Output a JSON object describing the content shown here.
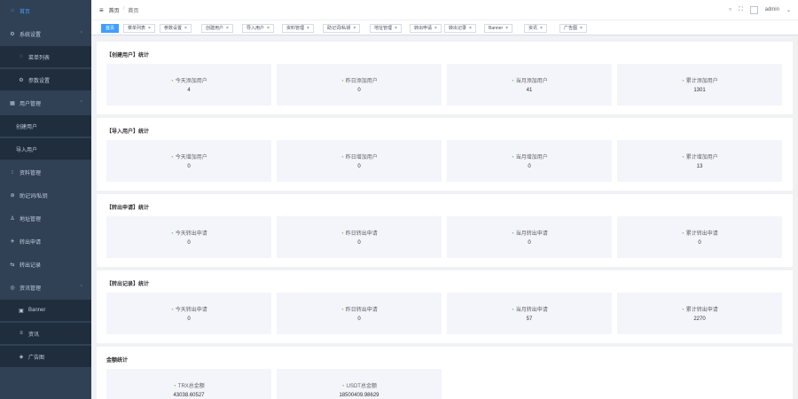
{
  "sidebar": {
    "items": [
      {
        "label": "首页",
        "icon": "home-icon",
        "glyph": "⌂"
      },
      {
        "label": "系统设置",
        "icon": "gear-icon",
        "glyph": "⚙",
        "arrow": "⌃"
      },
      {
        "label": "菜单列表",
        "icon": "menu-icon",
        "glyph": "◌"
      },
      {
        "label": "参数设置",
        "icon": "settings-icon",
        "glyph": "⚙"
      },
      {
        "label": "用户管理",
        "icon": "user-group-icon",
        "glyph": "▦",
        "arrow": "⌃"
      },
      {
        "label": "创建用户",
        "icon": "",
        "glyph": ""
      },
      {
        "label": "导入用户",
        "icon": "",
        "glyph": ""
      },
      {
        "label": "资料管理",
        "icon": "asset-icon",
        "glyph": "⁝"
      },
      {
        "label": "助记词/私钥",
        "icon": "key-icon",
        "glyph": "⊛"
      },
      {
        "label": "地址管理",
        "icon": "person-icon",
        "glyph": "♙"
      },
      {
        "label": "转出申请",
        "icon": "send-icon",
        "glyph": "✈"
      },
      {
        "label": "转出记录",
        "icon": "record-icon",
        "glyph": "⇆"
      },
      {
        "label": "资讯管理",
        "icon": "news-icon",
        "glyph": "◎",
        "arrow": "⌃"
      },
      {
        "label": "Banner",
        "icon": "image-icon",
        "glyph": "▣"
      },
      {
        "label": "资讯",
        "icon": "article-icon",
        "glyph": "≡"
      },
      {
        "label": "广告图",
        "icon": "ad-icon",
        "glyph": "◈"
      }
    ]
  },
  "header": {
    "crumb_home": "首页",
    "crumb_sep": "/",
    "crumb_current": "首页",
    "user": "admin",
    "hamburger_glyph": "≡",
    "search_glyph": "○",
    "fullscreen_glyph": "⛶",
    "dropdown_glyph": "⌄"
  },
  "tags": [
    {
      "label": "首页",
      "active": true
    },
    {
      "label": "菜单列表"
    },
    {
      "label": "参数设置"
    },
    {
      "label": "创建用户"
    },
    {
      "label": "导入用户"
    },
    {
      "label": "资料管理"
    },
    {
      "label": "助记词/私钥"
    },
    {
      "label": "地址管理"
    },
    {
      "label": "转出申请"
    },
    {
      "label": "转出记录"
    },
    {
      "label": "Banner"
    },
    {
      "label": "资讯"
    },
    {
      "label": "广告图"
    }
  ],
  "sections": [
    {
      "title": "【创建用户】统计",
      "cards": [
        {
          "label": "今天添加用户",
          "value": "4"
        },
        {
          "label": "昨日添加用户",
          "value": "0"
        },
        {
          "label": "当月添加用户",
          "value": "41"
        },
        {
          "label": "累计添加用户",
          "value": "1301"
        }
      ]
    },
    {
      "title": "【导入用户】统计",
      "cards": [
        {
          "label": "今天增加用户",
          "value": "0"
        },
        {
          "label": "昨日增加用户",
          "value": "0"
        },
        {
          "label": "当月增加用户",
          "value": "0"
        },
        {
          "label": "累计增加用户",
          "value": "13"
        }
      ]
    },
    {
      "title": "【转出申请】统计",
      "cards": [
        {
          "label": "今天转出申请",
          "value": "0"
        },
        {
          "label": "昨日转出申请",
          "value": "0"
        },
        {
          "label": "当月转出申请",
          "value": "0"
        },
        {
          "label": "累计转出申请",
          "value": "0"
        }
      ]
    },
    {
      "title": "【转出记录】统计",
      "cards": [
        {
          "label": "今天转出申请",
          "value": "0"
        },
        {
          "label": "昨日转出申请",
          "value": "0"
        },
        {
          "label": "当月转出申请",
          "value": "57"
        },
        {
          "label": "累计转出申请",
          "value": "2270"
        }
      ]
    },
    {
      "title": "金额统计",
      "cards": [
        {
          "label": "TRX总金额",
          "value": "43038.60527"
        },
        {
          "label": "USDT总金额",
          "value": "18500409.98629"
        }
      ]
    }
  ],
  "colors": {
    "sidebar_bg": "#304156",
    "sidebar_sub_bg": "#1f2d3d",
    "accent": "#409eff",
    "card_icon": "#67c23a"
  }
}
